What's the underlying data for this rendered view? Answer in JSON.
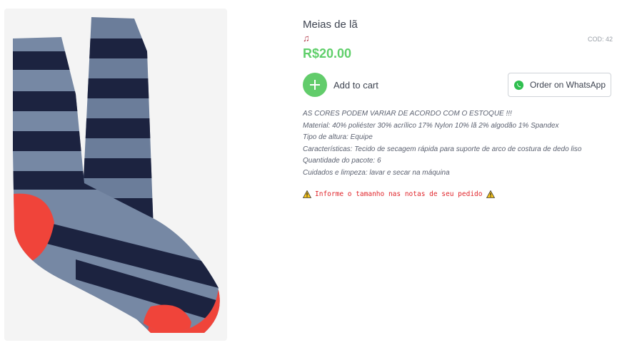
{
  "product": {
    "title": "Meias de lã",
    "emoji": "♫",
    "code": "COD: 42",
    "price": "R$20.00"
  },
  "actions": {
    "add_to_cart_label": "Add to cart",
    "whatsapp_label": "Order on WhatsApp"
  },
  "description": [
    "AS CORES PODEM VARIAR DE ACORDO COM O ESTOQUE !!!",
    "Material: 40% poliéster 30% acrílico 17% Nylon 10% lã 2% algodão 1% Spandex",
    "Tipo de altura: Equipe",
    "Características: Tecido de secagem rápida para suporte de arco de costura de dedo liso",
    "Quantidade do pacote: 6",
    "Cuidados e limpeza: lavar e secar na máquina"
  ],
  "notice": "Informe o tamanho nas notas de seu pedido",
  "icons": {
    "add": "plus-icon",
    "whatsapp": "whatsapp-icon",
    "warning": "warning-icon"
  },
  "colors": {
    "price": "#5fcf6a",
    "add_button": "#62cc6b",
    "notice": "#e0252b",
    "sock_navy": "#1c2340",
    "sock_heather": "#6b7d9a",
    "sock_red": "#f0443a"
  }
}
